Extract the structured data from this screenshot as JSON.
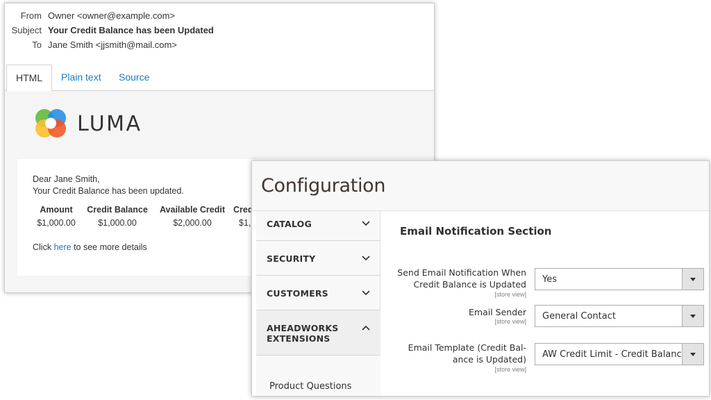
{
  "email": {
    "header": {
      "from_label": "From",
      "from_value": "Owner <owner@example.com>",
      "subject_label": "Subject",
      "subject_value": "Your Credit Balance has been Updated",
      "to_label": "To",
      "to_value": "Jane Smith <jjsmith@mail.com>"
    },
    "tabs": [
      {
        "label": "HTML",
        "active": true
      },
      {
        "label": "Plain text",
        "active": false
      },
      {
        "label": "Source",
        "active": false
      }
    ],
    "logo_text": "LUMA",
    "greeting": "Dear Jane Smith,",
    "message": "Your Credit Balance has been updated.",
    "table": {
      "headers": [
        "Amount",
        "Credit Balance",
        "Available Credit",
        "Cred"
      ],
      "row": [
        "$1,000.00",
        "$1,000.00",
        "$2,000.00",
        "$1,"
      ]
    },
    "more_prefix": "Click ",
    "more_link": "here",
    "more_suffix": " to see more details",
    "link_color": "#1979c3"
  },
  "config": {
    "title": "Configuration",
    "nav": [
      {
        "label": "CATALOG",
        "expanded": false
      },
      {
        "label": "SECURITY",
        "expanded": false
      },
      {
        "label": "CUSTOMERS",
        "expanded": false
      },
      {
        "label": "AHEADWORKS EXTENSIONS",
        "expanded": true
      }
    ],
    "nav_sub_item": "Product Questions",
    "section_title": "Email Notification Section",
    "fields": [
      {
        "label_line1": "Send Email Notification When",
        "label_line2": "Credit Balance is Updated",
        "scope": "[store view]",
        "value": "Yes"
      },
      {
        "label_line1": "Email Sender",
        "label_line2": "",
        "scope": "[store view]",
        "value": "General Contact"
      },
      {
        "label_line1": "Email Template (Credit Bal-",
        "label_line2": "ance is Updated)",
        "scope": "[store view]",
        "value": "AW Credit Limit - Credit Balance i"
      }
    ]
  }
}
